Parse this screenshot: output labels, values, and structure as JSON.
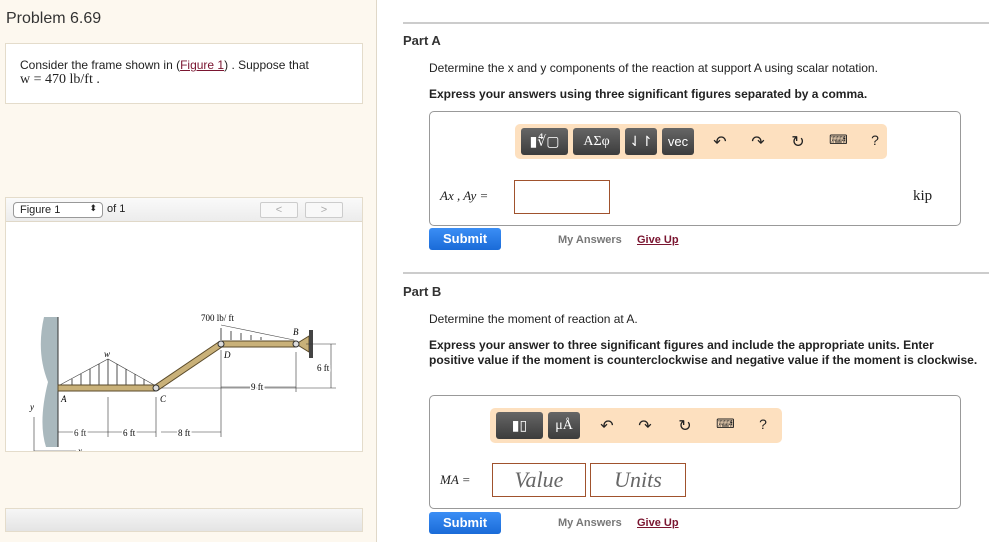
{
  "problem": {
    "title": "Problem 6.69",
    "text_pre": "Consider the frame shown in (",
    "figure_link": "Figure 1",
    "text_post": ") . Suppose that",
    "w_line": "w = 470 lb/ft ."
  },
  "figure": {
    "select": "Figure 1",
    "of": "of 1",
    "prev": "<",
    "next": ">",
    "labels": {
      "load": "700 lb/ ft",
      "w": "w",
      "A": "A",
      "B": "B",
      "C": "C",
      "D": "D",
      "d1": "6 ft",
      "d2": "6 ft",
      "d3": "8 ft",
      "d4": "9 ft",
      "d5": "6 ft",
      "x": "x",
      "y": "y"
    }
  },
  "partA": {
    "title": "Part A",
    "question": "Determine the x and y components of the reaction at support A using scalar notation.",
    "instruction": "Express your answers using three significant figures separated by a comma.",
    "toolbar": {
      "templates": "▮∜▢",
      "greek": "ΑΣφ",
      "arrows": "⇃↾",
      "vec": "vec",
      "help": "?"
    },
    "label": "Ax , Ay =",
    "unit": "kip",
    "submit": "Submit",
    "my_answers": "My Answers",
    "give_up": "Give Up"
  },
  "partB": {
    "title": "Part B",
    "question": "Determine the moment of reaction at A.",
    "instruction": "Express your answer to three significant figures and include the appropriate units. Enter positive value if the moment is counterclockwise and negative value if the moment is clockwise.",
    "toolbar": {
      "templates": "▮▯",
      "units": "μÅ",
      "help": "?"
    },
    "label": "MA =",
    "value_placeholder": "Value",
    "units_placeholder": "Units",
    "submit": "Submit",
    "my_answers": "My Answers",
    "give_up": "Give Up"
  }
}
